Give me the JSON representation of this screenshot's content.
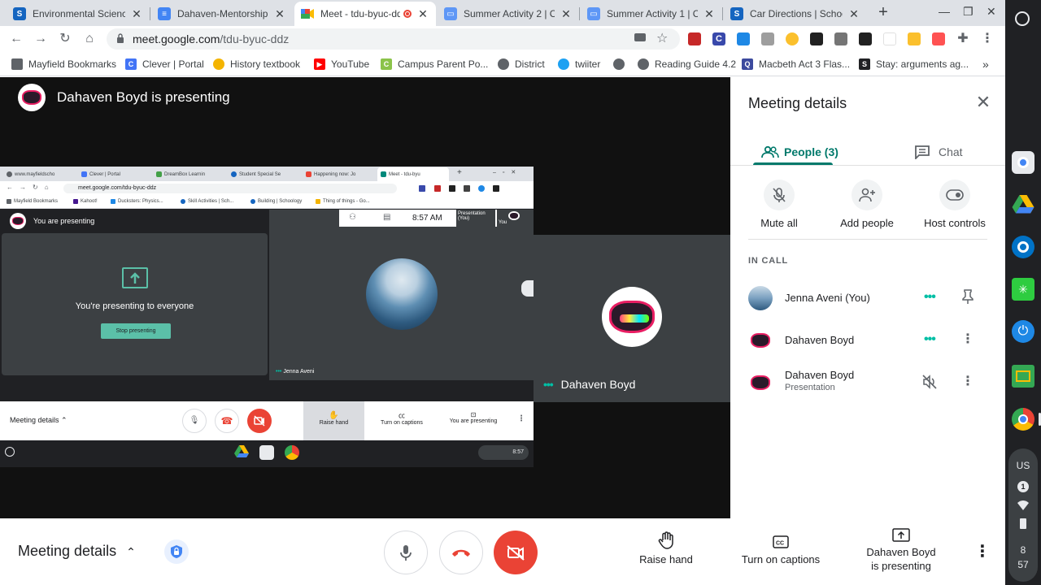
{
  "browser": {
    "tabs": [
      {
        "title": "Environmental Science",
        "favicon": "schoology-icon",
        "color": "#1565c0",
        "letter": "S"
      },
      {
        "title": "Dahaven-Mentorship P",
        "favicon": "docs-icon",
        "color": "#4285f4",
        "letter": ""
      },
      {
        "title": "Meet - tdu-byuc-dd",
        "favicon": "meet-icon",
        "color": "#00897b",
        "letter": "",
        "active": true
      },
      {
        "title": "Summer Activity 2 | Co",
        "favicon": "classroom-icon",
        "color": "#5e97f6",
        "letter": ""
      },
      {
        "title": "Summer Activity 1 | Co",
        "favicon": "classroom-icon",
        "color": "#5e97f6",
        "letter": ""
      },
      {
        "title": "Car Directions | Schoo",
        "favicon": "schoology-icon",
        "color": "#1565c0",
        "letter": "S"
      }
    ],
    "url_host": "meet.google.com",
    "url_path": "/tdu-byuc-ddz",
    "bookmarks": [
      {
        "label": "Mayfield Bookmarks",
        "icon": "folder-icon",
        "color": "#5f6368"
      },
      {
        "label": "Clever | Portal",
        "icon": "clever-icon",
        "color": "#4274f6"
      },
      {
        "label": "History textbook",
        "icon": "textbook-icon",
        "color": "#f4b400"
      },
      {
        "label": "YouTube",
        "icon": "youtube-icon",
        "color": "#ff0000"
      },
      {
        "label": "Campus Parent Po...",
        "icon": "campus-icon",
        "color": "#8bc34a"
      },
      {
        "label": "District",
        "icon": "globe-icon",
        "color": "#5f6368"
      },
      {
        "label": "twiiter",
        "icon": "twitter-icon",
        "color": "#1da1f2"
      },
      {
        "label": "",
        "icon": "globe-icon",
        "color": "#5f6368"
      },
      {
        "label": "Reading Guide 4.2",
        "icon": "globe-icon",
        "color": "#5f6368"
      },
      {
        "label": "Macbeth Act 3 Flas...",
        "icon": "quizlet-icon",
        "color": "#3c4a9e"
      },
      {
        "label": "Stay: arguments ag...",
        "icon": "study-icon",
        "color": "#202124"
      }
    ],
    "bookmarks_overflow": "»"
  },
  "meet": {
    "presenting_title": "Dahaven Boyd is presenting",
    "tile_name": "Dahaven Boyd",
    "nested": {
      "tabs": [
        "www.mayfieldscho",
        "Clever | Portal",
        "DreamBox Learnin",
        "Student Special Se",
        "Happening now: Jo",
        "Meet - tdu-byu"
      ],
      "url": "meet.google.com/tdu-byuc-ddz",
      "bookmarks": [
        "Mayfield Bookmarks",
        "Kahoot!",
        "Ducksters: Physics...",
        "Skill Activities | Sch...",
        "Building | Schoology",
        "Thing of things - Go..."
      ],
      "you_presenting": "You are presenting",
      "presenting_everyone": "You're presenting to everyone",
      "stop_presenting": "Stop presenting",
      "time": "8:57 AM",
      "presentation_label": "Presentation",
      "you_label": "(You)",
      "you_short": "You",
      "jenna_name": "Jenna Aveni",
      "meeting_details": "Meeting details",
      "raise_hand": "Raise hand",
      "captions": "Turn on captions",
      "you_are_presenting": "You are presenting",
      "shelf_time": "8:57"
    }
  },
  "panel": {
    "title": "Meeting details",
    "tab_people": "People (3)",
    "tab_chat": "Chat",
    "actions": [
      {
        "label": "Mute all",
        "icon": "mic-off-icon"
      },
      {
        "label": "Add people",
        "icon": "add-person-icon"
      },
      {
        "label": "Host controls",
        "icon": "toggle-icon"
      }
    ],
    "section": "IN CALL",
    "people": [
      {
        "name": "Jenna Aveni (You)",
        "sub": "",
        "status": "speaking-dots-icon",
        "action": "pin-icon"
      },
      {
        "name": "Dahaven Boyd",
        "sub": "",
        "status": "speaking-dots-icon",
        "action": "more-icon"
      },
      {
        "name": "Dahaven Boyd",
        "sub": "Presentation",
        "status": "volume-off-icon",
        "action": "more-icon"
      }
    ]
  },
  "controls": {
    "meeting_details": "Meeting details",
    "raise_hand": "Raise hand",
    "captions": "Turn on captions",
    "presenting": "Dahaven Boyd\nis presenting"
  },
  "shelf": {
    "locale": "US",
    "notif_count": "1",
    "clock_hour": "8",
    "clock_min": "57"
  },
  "colors": {
    "accent": "#00796b",
    "end_call": "#ea4335",
    "teal": "#5bc0a8"
  }
}
